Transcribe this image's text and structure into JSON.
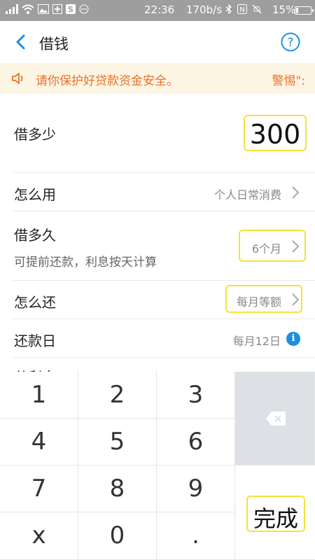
{
  "status_bar": {
    "time": "22:36",
    "speed": "170b/s",
    "battery_pct": "15%",
    "battery_level": 0.15
  },
  "nav": {
    "title": "借钱"
  },
  "banner": {
    "message": "请你保护好贷款资金安全。",
    "warn": "警惕\":"
  },
  "form": {
    "amount_label": "借多少",
    "amount_value": "300",
    "usage_label": "怎么用",
    "usage_value": "个人日常消费",
    "term_label": "借多久",
    "term_note": "可提前还款，利息按天计算",
    "term_value": "6个月",
    "repay_label": "怎么还",
    "repay_value": "每月等额",
    "due_label": "还款日",
    "due_value": "每月12日",
    "interest_label": "总利息"
  },
  "keypad": {
    "keys": [
      "1",
      "2",
      "3",
      "4",
      "5",
      "6",
      "7",
      "8",
      "9",
      "x",
      "0",
      "."
    ],
    "done": "完成"
  },
  "colors": {
    "accent_blue": "#1a8fe3",
    "warning_orange": "#e8732a",
    "highlight_yellow": "#f3e33a"
  }
}
